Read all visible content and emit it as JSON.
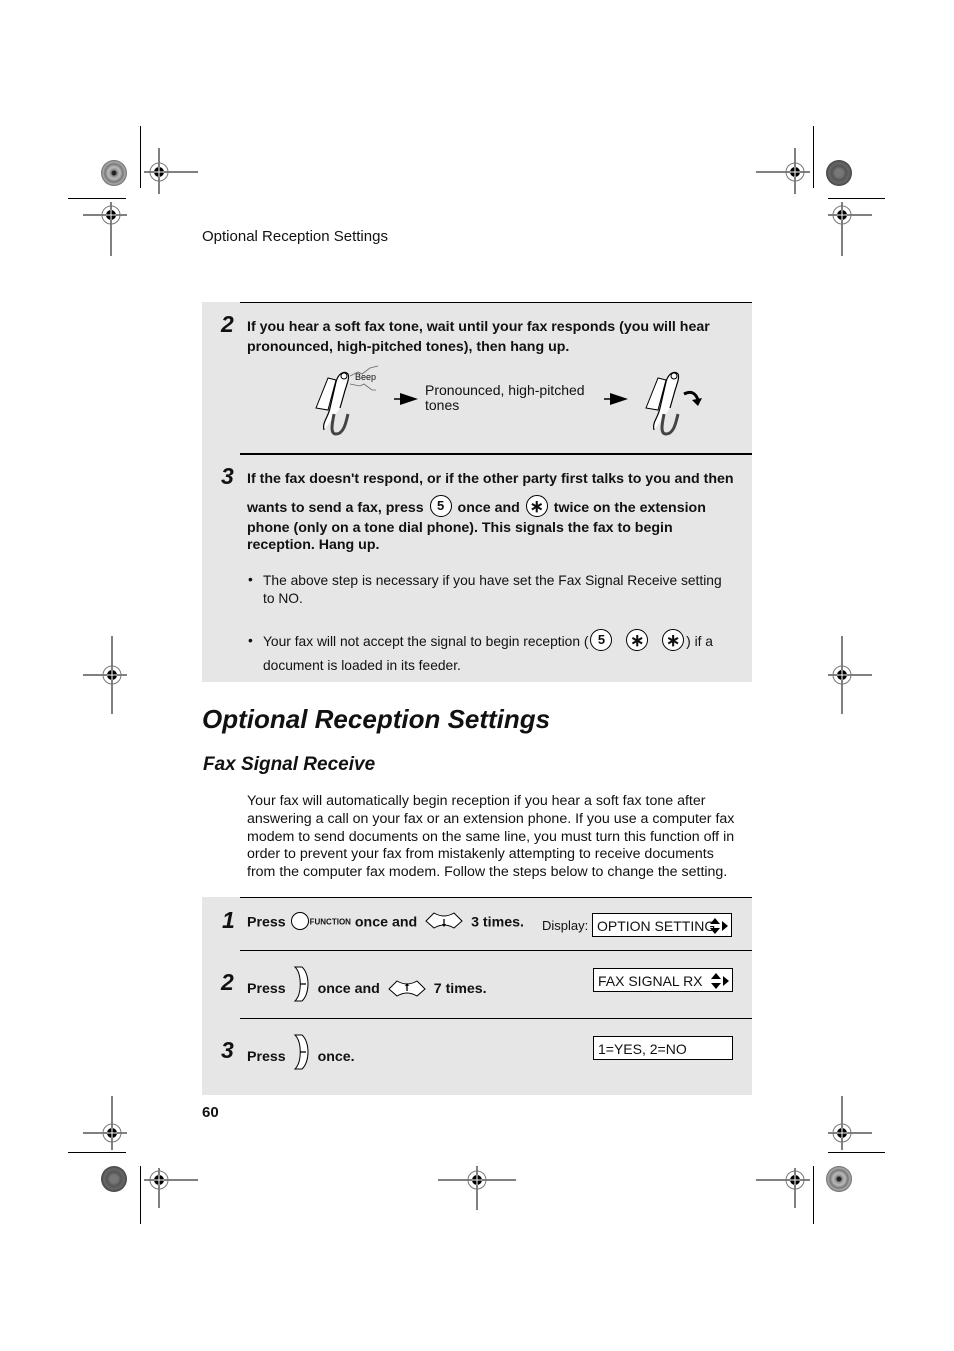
{
  "running_head": "Optional Reception Settings",
  "page_number": "60",
  "top_panel": {
    "step2": {
      "number": "2",
      "text_line1": "If you hear a soft fax tone, wait until your fax responds (you will hear",
      "text_line2": "pronounced, high-pitched tones), then hang up.",
      "illustration": {
        "beep_label": "Beep",
        "tones_label_line1": "Pronounced, high-pitched",
        "tones_label_line2": "tones",
        "icons": [
          "handset-beep-icon",
          "arrow-right-icon",
          "arrow-right-icon",
          "handset-hangup-icon"
        ]
      }
    },
    "step3": {
      "number": "3",
      "line1": "If the fax doesn't respond, or if the other party first talks to you and then",
      "line2_a": "wants to send a fax, press",
      "key_5": "5",
      "line2_b": "once and",
      "key_star": "∗",
      "line2_c": "twice on the extension",
      "line3": "phone (only on a tone dial phone). This signals the fax to begin",
      "line4": "reception. Hang up.",
      "bullets": [
        {
          "line1": "The above step is necessary if you have set the Fax Signal Receive setting",
          "line2": "to NO."
        },
        {
          "line1_a": "Your fax will not accept the signal to begin reception (",
          "keys": [
            "5",
            "∗",
            "∗"
          ],
          "line1_b": ") if a",
          "line2": "document is loaded in its feeder."
        }
      ]
    }
  },
  "section_title": "Optional Reception Settings",
  "subsection_title": "Fax Signal Receive",
  "intro_lines": [
    "Your fax will automatically begin reception if you hear a soft fax tone after",
    "answering a call on your fax or an extension phone. If you use a computer fax",
    "modem to send documents on the same line, you must turn this function off in",
    "order to prevent your fax from mistakenly attempting to receive documents",
    "from the computer fax modem. Follow the steps below to change the setting."
  ],
  "steps": [
    {
      "number": "1",
      "press": "Press",
      "key1_label": "FUNCTION",
      "mid": "once and",
      "end": "3 times.",
      "display_label": "Display:",
      "display_value": "OPTION SETTING"
    },
    {
      "number": "2",
      "press": "Press",
      "mid": "once and",
      "end": "7 times.",
      "display_value": "FAX SIGNAL RX"
    },
    {
      "number": "3",
      "press": "Press",
      "end": "once.",
      "display_value": "1=YES, 2=NO"
    }
  ]
}
